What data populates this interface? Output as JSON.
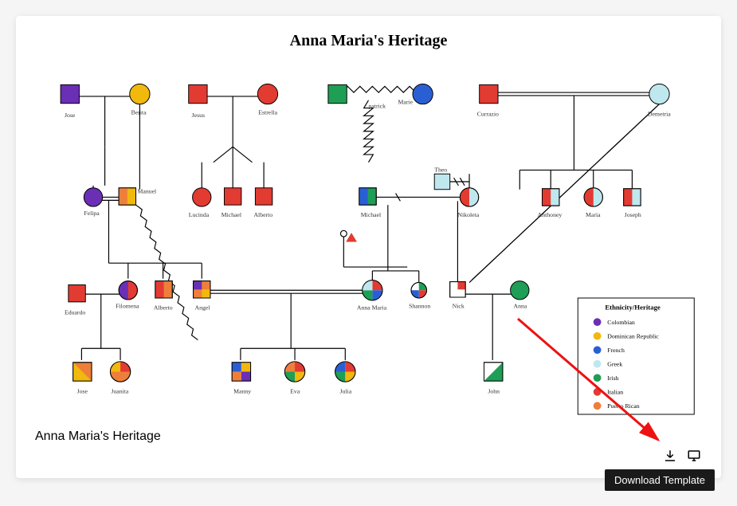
{
  "title": "Anna Maria's Heritage",
  "caption": "Anna Maria's Heritage",
  "tooltip": "Download Template",
  "legend": {
    "title": "Ethnicity/Heritage",
    "items": [
      {
        "label": "Colombian",
        "color": "#6a2fb5"
      },
      {
        "label": "Dominican Republic",
        "color": "#f1b80e"
      },
      {
        "label": "French",
        "color": "#2a5fd4"
      },
      {
        "label": "Greek",
        "color": "#bfe7ee"
      },
      {
        "label": "Irish",
        "color": "#1f9e55"
      },
      {
        "label": "Italian",
        "color": "#e23b32"
      },
      {
        "label": "Puerto Rican",
        "color": "#ee7f3a"
      }
    ]
  },
  "people": {
    "jose": "Jose",
    "berita": "Berita",
    "jesus": "Jesus",
    "estrella": "Estrella",
    "patrick": "patrick",
    "marie": "Marie",
    "currazio": "Currazio",
    "demetria": "Demetria",
    "felipa": "Felipa",
    "manuel": "Manuel",
    "lucinda": "Lucinda",
    "michael1": "Michael",
    "alberto_sr": "Alberto",
    "michael2": "Michael",
    "theo": "Theo",
    "nikoleta": "Nikoleta",
    "anthoney": "Anthoney",
    "maria_jr": "Maria",
    "joseph": "Joseph",
    "eduardo": "Eduardo",
    "filomena": "Filomena",
    "alberto_jr": "Alberto",
    "angel": "Angel",
    "anna_maria": "Anna Maria",
    "shannon": "Shannon",
    "nick": "Nick",
    "anna": "Anna",
    "jose_jr": "Jose",
    "juanita": "Juanita",
    "manny": "Manny",
    "eva": "Eva",
    "julia": "Julia",
    "john": "John"
  },
  "chart_data": {
    "type": "genogram",
    "description": "Family heritage genogram. Squares = male, circles = female. Colors map to ethnicities in the legend. Horizontal lines are pair bonds; vertical lines descend to children. Zig-zag connector denotes a conflictual relationship; double-slash on a line denotes divorce/separation; double parallel line denotes a committed non-married bond.",
    "ethnicity_colors": {
      "Colombian": "#6a2fb5",
      "Dominican Republic": "#f1b80e",
      "French": "#2a5fd4",
      "Greek": "#bfe7ee",
      "Irish": "#1f9e55",
      "Italian": "#e23b32",
      "Puerto Rican": "#ee7f3a"
    },
    "people": [
      {
        "id": "jose",
        "sex": "M",
        "heritage": [
          "Colombian"
        ],
        "gen": 1
      },
      {
        "id": "berita",
        "sex": "F",
        "heritage": [
          "Dominican Republic"
        ],
        "gen": 1
      },
      {
        "id": "jesus",
        "sex": "M",
        "heritage": [
          "Italian"
        ],
        "gen": 1
      },
      {
        "id": "estrella",
        "sex": "F",
        "heritage": [
          "Italian"
        ],
        "gen": 1
      },
      {
        "id": "patrick",
        "sex": "M",
        "heritage": [
          "Irish"
        ],
        "gen": 1
      },
      {
        "id": "marie",
        "sex": "F",
        "heritage": [
          "French"
        ],
        "gen": 1
      },
      {
        "id": "currazio",
        "sex": "M",
        "heritage": [
          "Italian"
        ],
        "gen": 1
      },
      {
        "id": "demetria",
        "sex": "F",
        "heritage": [
          "Greek"
        ],
        "gen": 1
      },
      {
        "id": "felipa",
        "sex": "F",
        "heritage": [
          "Colombian"
        ],
        "gen": 2
      },
      {
        "id": "manuel",
        "sex": "M",
        "heritage": [
          "Dominican Republic",
          "Puerto Rican"
        ],
        "gen": 2
      },
      {
        "id": "lucinda",
        "sex": "F",
        "heritage": [
          "Italian"
        ],
        "gen": 2
      },
      {
        "id": "michael1",
        "sex": "M",
        "heritage": [
          "Italian"
        ],
        "gen": 2
      },
      {
        "id": "alberto_sr",
        "sex": "M",
        "heritage": [
          "Italian"
        ],
        "gen": 2
      },
      {
        "id": "michael2",
        "sex": "M",
        "heritage": [
          "Irish",
          "French"
        ],
        "gen": 2
      },
      {
        "id": "theo",
        "sex": "M",
        "heritage": [
          "Greek"
        ],
        "gen": 2
      },
      {
        "id": "nikoleta",
        "sex": "F",
        "heritage": [
          "Greek",
          "Italian"
        ],
        "gen": 2
      },
      {
        "id": "anthoney",
        "sex": "M",
        "heritage": [
          "Greek",
          "Italian"
        ],
        "gen": 2
      },
      {
        "id": "maria_jr",
        "sex": "F",
        "heritage": [
          "Greek",
          "Italian"
        ],
        "gen": 2
      },
      {
        "id": "joseph",
        "sex": "M",
        "heritage": [
          "Greek",
          "Italian"
        ],
        "gen": 2
      },
      {
        "id": "eduardo",
        "sex": "M",
        "heritage": [
          "Italian"
        ],
        "gen": 3
      },
      {
        "id": "filomena",
        "sex": "F",
        "heritage": [
          "Italian",
          "Colombian"
        ],
        "gen": 3
      },
      {
        "id": "alberto_jr",
        "sex": "M",
        "heritage": [
          "Italian",
          "Puerto Rican"
        ],
        "gen": 3
      },
      {
        "id": "angel",
        "sex": "M",
        "heritage": [
          "Puerto Rican",
          "Colombian",
          "Dominican Republic"
        ],
        "gen": 3
      },
      {
        "id": "anna_maria",
        "sex": "F",
        "heritage": [
          "Italian",
          "Irish",
          "French",
          "Greek"
        ],
        "gen": 3
      },
      {
        "id": "shannon",
        "sex": "F",
        "heritage": [
          "Irish",
          "Italian",
          "French"
        ],
        "gen": 3
      },
      {
        "id": "nick",
        "sex": "M",
        "heritage": [
          "Greek",
          "Italian"
        ],
        "gen": 3
      },
      {
        "id": "anna",
        "sex": "F",
        "heritage": [
          "Irish"
        ],
        "gen": 3
      },
      {
        "id": "jose_jr",
        "sex": "M",
        "heritage": [
          "Dominican Republic",
          "Puerto Rican",
          "Colombian"
        ],
        "gen": 4
      },
      {
        "id": "juanita",
        "sex": "F",
        "heritage": [
          "Italian",
          "Puerto Rican",
          "Dominican Republic"
        ],
        "gen": 4
      },
      {
        "id": "manny",
        "sex": "M",
        "heritage": [
          "Puerto Rican",
          "Dominican Republic",
          "Colombian",
          "French"
        ],
        "gen": 4
      },
      {
        "id": "eva",
        "sex": "F",
        "heritage": [
          "Italian",
          "Irish",
          "Puerto Rican",
          "Dominican Republic"
        ],
        "gen": 4
      },
      {
        "id": "julia",
        "sex": "F",
        "heritage": [
          "Italian",
          "Irish",
          "Dominican Republic",
          "French"
        ],
        "gen": 4
      },
      {
        "id": "john",
        "sex": "M",
        "heritage": [
          "Irish",
          "Greek"
        ],
        "gen": 4
      }
    ],
    "unions": [
      {
        "a": "jose",
        "b": "berita",
        "children": [
          "felipa"
        ]
      },
      {
        "a": "jesus",
        "b": "estrella",
        "children": [
          "lucinda",
          "michael1",
          "alberto_sr"
        ]
      },
      {
        "a": "patrick",
        "b": "marie",
        "children": [
          "michael2"
        ],
        "rel": "conflictual"
      },
      {
        "a": "currazio",
        "b": "demetria",
        "children": [
          "nikoleta",
          "anthoney",
          "maria_jr",
          "joseph"
        ],
        "rel": "double"
      },
      {
        "a": "felipa",
        "b": "manuel",
        "children": [
          "filomena",
          "alberto_jr",
          "angel"
        ],
        "rel": "committed-double"
      },
      {
        "a": "michael2",
        "b": "nikoleta",
        "children": [
          "anna_maria",
          "shannon"
        ],
        "rel": "separated"
      },
      {
        "a": "theo",
        "b": "nikoleta",
        "children": [
          "nick"
        ],
        "rel": "divorced"
      },
      {
        "a": "eduardo",
        "b": "filomena",
        "children": [
          "jose_jr",
          "juanita"
        ]
      },
      {
        "a": "angel",
        "b": "anna_maria",
        "children": [
          "manny",
          "eva",
          "julia"
        ],
        "rel": "double"
      },
      {
        "a": "nick",
        "b": "anna",
        "children": [
          "john"
        ]
      }
    ]
  }
}
